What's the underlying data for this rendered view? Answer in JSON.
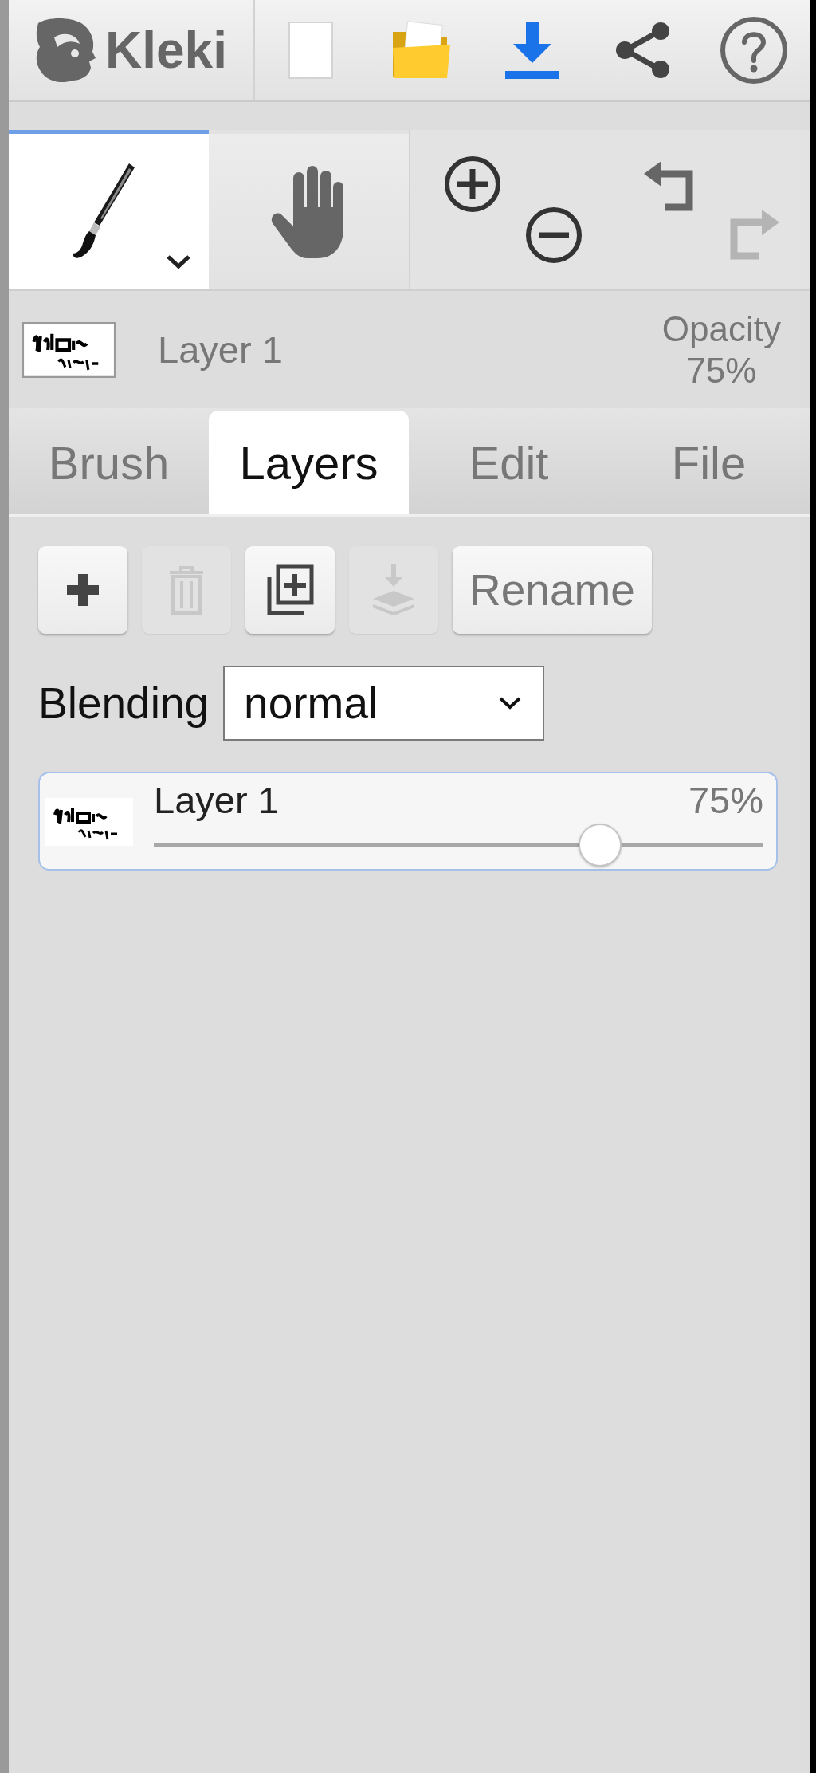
{
  "top_bar": {
    "logo": "Kleki",
    "actions": [
      {
        "kind": "new"
      },
      {
        "kind": "open"
      },
      {
        "kind": "save"
      },
      {
        "kind": "share"
      },
      {
        "kind": "help"
      }
    ]
  },
  "tools": [
    {
      "kind": "brush",
      "selected": true
    },
    {
      "kind": "hand",
      "selected": false
    }
  ],
  "view_controls": [
    {
      "kind": "zoom-in",
      "disabled": false
    },
    {
      "kind": "zoom-out",
      "disabled": false
    },
    {
      "kind": "undo",
      "disabled": false
    },
    {
      "kind": "redo",
      "disabled": true
    }
  ],
  "current_layer": {
    "name": "Layer 1",
    "opacity_label": "Opacity",
    "opacity": "75%"
  },
  "tabs": [
    {
      "label": "Brush",
      "selected": false
    },
    {
      "label": "Layers",
      "selected": true
    },
    {
      "label": "Edit",
      "selected": false
    },
    {
      "label": "File",
      "selected": false
    }
  ],
  "layer_actions": [
    {
      "kind": "add",
      "disabled": false
    },
    {
      "kind": "delete",
      "disabled": true
    },
    {
      "kind": "duplicate",
      "disabled": false
    },
    {
      "kind": "merge",
      "disabled": true
    },
    {
      "kind": "rename",
      "label": "Rename",
      "disabled": false
    }
  ],
  "blending": {
    "label": "Blending",
    "value": "normal"
  },
  "layers": [
    {
      "name": "Layer 1",
      "opacity": "75%",
      "level": 0.75,
      "selected": true
    }
  ]
}
